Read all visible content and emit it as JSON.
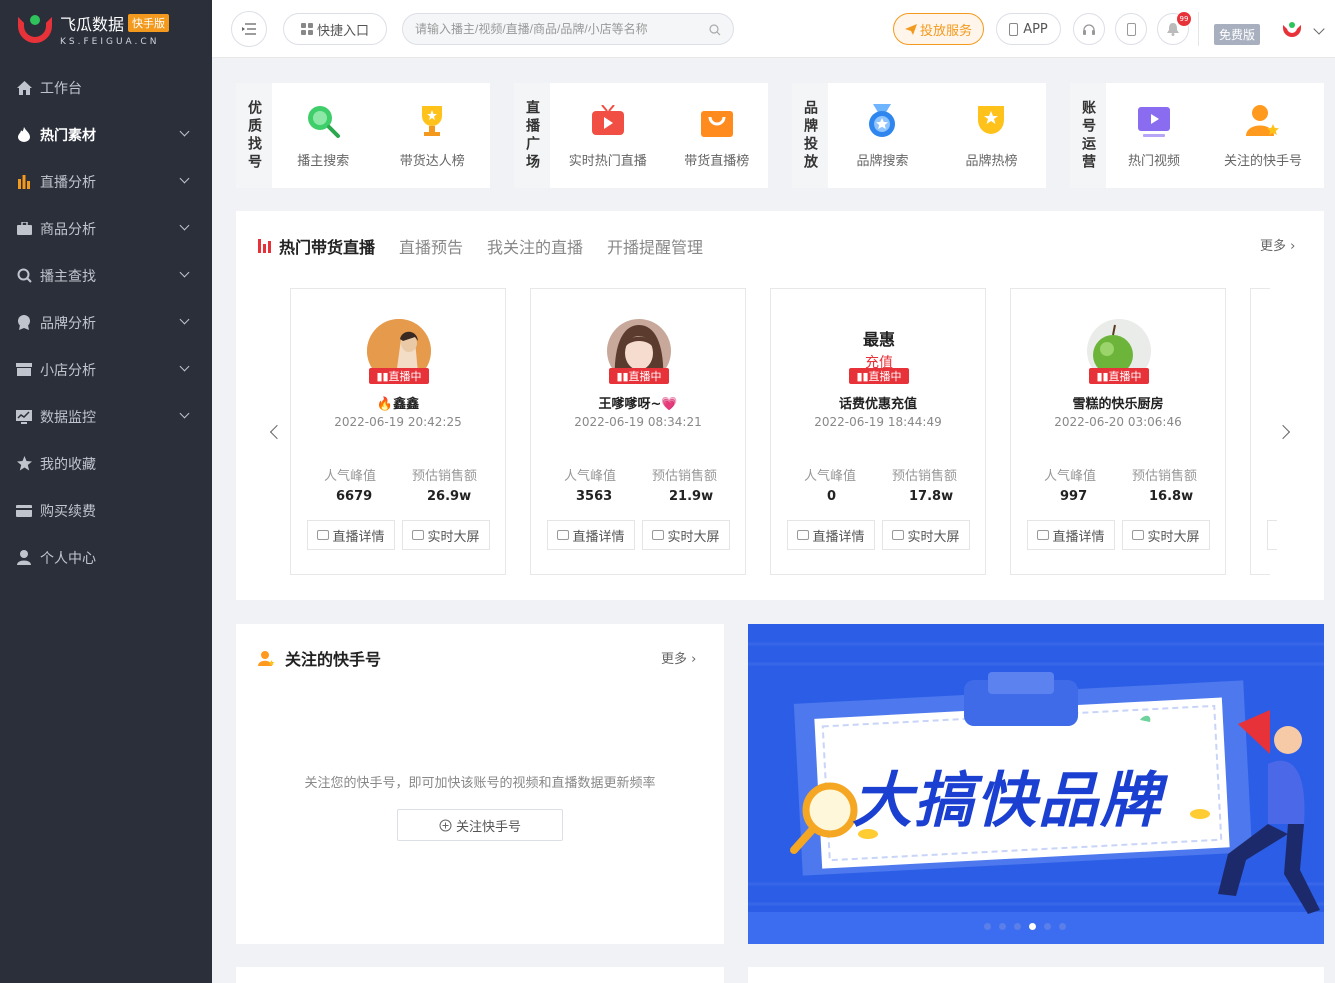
{
  "brand": {
    "name": "飞瓜数据",
    "tag": "快手版",
    "sub": "KS.FEIGUA.CN"
  },
  "sidebar": {
    "items": [
      {
        "label": "工作台",
        "icon": "home-icon",
        "caret": false
      },
      {
        "label": "热门素材",
        "icon": "fire-icon",
        "caret": true
      },
      {
        "label": "直播分析",
        "icon": "bar-chart-icon",
        "caret": true
      },
      {
        "label": "商品分析",
        "icon": "bag-icon",
        "caret": true
      },
      {
        "label": "播主查找",
        "icon": "search-icon",
        "caret": true
      },
      {
        "label": "品牌分析",
        "icon": "medal-icon",
        "caret": true
      },
      {
        "label": "小店分析",
        "icon": "shop-icon",
        "caret": true
      },
      {
        "label": "数据监控",
        "icon": "monitor-icon",
        "caret": true
      },
      {
        "label": "我的收藏",
        "icon": "star-icon",
        "caret": false
      },
      {
        "label": "购买续费",
        "icon": "card-icon",
        "caret": false
      },
      {
        "label": "个人中心",
        "icon": "user-icon",
        "caret": false
      }
    ]
  },
  "header": {
    "quick_entry": "快捷入口",
    "search_placeholder": "请输入播主/视频/直播/商品/品牌/小店等名称",
    "ad_service": "投放服务",
    "app": "APP",
    "notice_count": "99",
    "plan": "免费版"
  },
  "quick_groups": [
    {
      "title": "优质找号",
      "items": [
        "播主搜索",
        "带货达人榜"
      ]
    },
    {
      "title": "直播广场",
      "items": [
        "实时热门直播",
        "带货直播榜"
      ]
    },
    {
      "title": "品牌投放",
      "items": [
        "品牌搜索",
        "品牌热榜"
      ]
    },
    {
      "title": "账号运营",
      "items": [
        "热门视频",
        "关注的快手号"
      ]
    }
  ],
  "live": {
    "tabs": [
      "热门带货直播",
      "直播预告",
      "我关注的直播",
      "开播提醒管理"
    ],
    "more": "更多",
    "live_tag": "直播中",
    "stat_labels": [
      "人气峰值",
      "预估销售额"
    ],
    "btn_detail": "直播详情",
    "btn_screen": "实时大屏",
    "cards": [
      {
        "name": "🔥鑫鑫",
        "time": "2022-06-19 20:42:25",
        "peak": "6679",
        "sales": "26.9w"
      },
      {
        "name": "王嗲嗲呀~💗",
        "time": "2022-06-19 08:34:21",
        "peak": "3563",
        "sales": "21.9w"
      },
      {
        "name": "话费优惠充值",
        "time": "2022-06-19 18:44:49",
        "peak": "0",
        "sales": "17.8w",
        "avatar_text": "最惠",
        "avatar_sub": "充值"
      },
      {
        "name": "雪糕的快乐厨房",
        "time": "2022-06-20 03:06:46",
        "peak": "997",
        "sales": "16.8w"
      }
    ]
  },
  "follow": {
    "title": "关注的快手号",
    "more": "更多",
    "empty": "关注您的快手号，即可加快该账号的视频和直播数据更新频率",
    "button": "关注快手号"
  },
  "banner": {
    "text": "大搞快品牌",
    "dots": 6,
    "active_dot": 3
  },
  "colors": {
    "accent": "#e8323a",
    "orange": "#f39a1e",
    "sidebar": "#2b2f3a",
    "banner": "#2b5de6"
  }
}
